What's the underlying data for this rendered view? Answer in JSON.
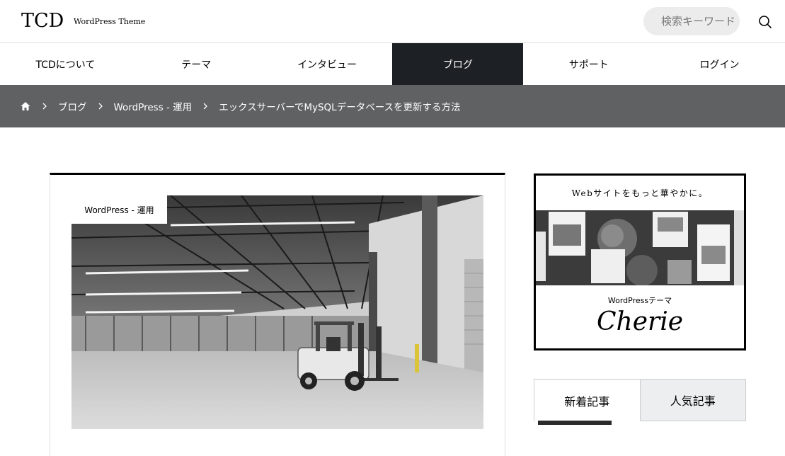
{
  "header": {
    "logo": "TCD",
    "logo_sub": "WordPress Theme",
    "search_placeholder": "検索キーワード"
  },
  "nav": {
    "items": [
      {
        "label": "TCDについて"
      },
      {
        "label": "テーマ"
      },
      {
        "label": "インタビュー"
      },
      {
        "label": "ブログ",
        "active": true
      },
      {
        "label": "サポート"
      },
      {
        "label": "ログイン"
      }
    ],
    "active_color": "#1d2024"
  },
  "breadcrumb": {
    "items": [
      "ブログ",
      "WordPress - 運用"
    ],
    "current": "エックスサーバーでMySQLデータベースを更新する方法",
    "background": "#5f6163"
  },
  "article": {
    "category": "WordPress - 運用"
  },
  "sidebar": {
    "ad": {
      "tagline": "Webサイトをもっと華やかに。",
      "subtitle": "WordPressテーマ",
      "brand": "Cherie"
    },
    "tabs": [
      {
        "label": "新着記事",
        "active": true
      },
      {
        "label": "人気記事",
        "active": false
      }
    ]
  },
  "icons": {
    "search": "search-icon",
    "home": "home-icon",
    "breadcrumb_separator": "chevron-right-icon"
  }
}
